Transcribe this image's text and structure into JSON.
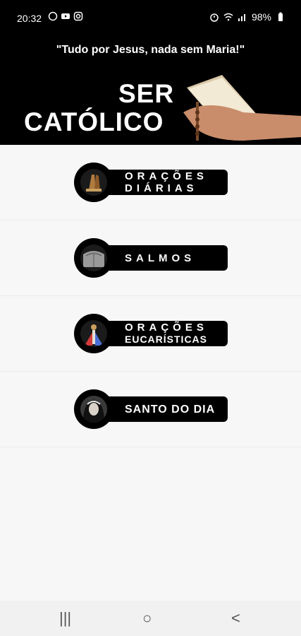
{
  "status_bar": {
    "time": "20:32",
    "battery": "98%",
    "left_icons": [
      "whatsapp-icon",
      "youtube-icon",
      "instagram-icon"
    ],
    "right_icons": [
      "alarm-icon",
      "wifi-icon",
      "signal-icon",
      "battery-icon"
    ]
  },
  "header": {
    "quote": "\"Tudo por Jesus, nada sem Maria!\"",
    "title_line1": "SER",
    "title_line2": "CATÓLICO"
  },
  "menu": {
    "items": [
      {
        "label_line1": "ORAÇÕES",
        "label_line2": "DIÁRIAS",
        "icon": "praying-hands-icon"
      },
      {
        "label_line1": "SALMOS",
        "label_line2": "",
        "icon": "stone-tablet-icon"
      },
      {
        "label_line1": "ORAÇÕES",
        "label_line2": "EUCARÍSTICAS",
        "icon": "divine-mercy-icon"
      },
      {
        "label_line1": "SANTO DO DIA",
        "label_line2": "",
        "icon": "saint-portrait-icon"
      }
    ]
  },
  "navbar": {
    "recent": "|||",
    "home": "○",
    "back": "<"
  }
}
